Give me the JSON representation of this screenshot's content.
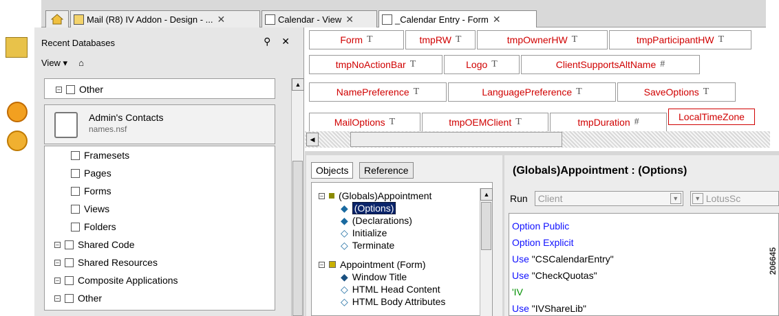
{
  "tabs": [
    {
      "label": "Mail (R8) IV Addon - Design - ...",
      "close": "✕"
    },
    {
      "label": "Calendar - View",
      "close": "✕"
    },
    {
      "label": "_Calendar Entry - Form",
      "close": "✕"
    }
  ],
  "panel": {
    "title": "Recent Databases",
    "actions": "⚲ ✕",
    "view_label": "View ▾",
    "items_top": [
      "Other"
    ],
    "db": {
      "name": "Admin's Contacts",
      "file": "names.nsf"
    },
    "items": [
      "Framesets",
      "Pages",
      "Forms",
      "Views",
      "Folders",
      "Shared Code",
      "Shared Resources",
      "Composite Applications",
      "Other"
    ]
  },
  "form_fields": [
    [
      "Form",
      "T"
    ],
    [
      "tmpRW",
      "T"
    ],
    [
      "tmpOwnerHW",
      "T"
    ],
    [
      "tmpParticipantHW",
      "T"
    ],
    [
      "tmpNoActionBar",
      "T"
    ],
    [
      "Logo",
      "T"
    ],
    [
      "ClientSupportsAltName",
      "#"
    ],
    [
      "NamePreference",
      "T"
    ],
    [
      "LanguagePreference",
      "T"
    ],
    [
      "SaveOptions",
      "T"
    ],
    [
      "MailOptions",
      "T"
    ],
    [
      "tmpOEMClient",
      "T"
    ],
    [
      "tmpDuration",
      "#"
    ],
    [
      "LocalTimeZone",
      ""
    ]
  ],
  "objects": {
    "tab_objects": "Objects",
    "tab_reference": "Reference",
    "tree": [
      {
        "label": "(Globals)Appointment",
        "level": 0
      },
      {
        "label": "(Options)",
        "level": 1,
        "selected": true
      },
      {
        "label": "(Declarations)",
        "level": 1
      },
      {
        "label": "Initialize",
        "level": 1
      },
      {
        "label": "Terminate",
        "level": 1
      },
      {
        "label": "Appointment (Form)",
        "level": 0
      },
      {
        "label": "Window Title",
        "level": 1
      },
      {
        "label": "HTML Head Content",
        "level": 1
      },
      {
        "label": "HTML Body Attributes",
        "level": 1
      }
    ]
  },
  "code": {
    "title": "(Globals)Appointment : (Options)",
    "run_label": "Run",
    "run_value": "Client",
    "lang_value": "LotusSc",
    "lines": [
      [
        "Option Public",
        ""
      ],
      [
        "Option Explicit",
        ""
      ],
      [
        "Use ",
        "\"CSCalendarEntry\""
      ],
      [
        "Use ",
        "\"CheckQuotas\""
      ],
      [
        "'IV",
        ""
      ],
      [
        "Use ",
        "\"IVShareLib\""
      ]
    ]
  },
  "watermark": "206645",
  "colors": {
    "field_text": "#d00000",
    "keyword": "#1010ff",
    "comment": "#009000"
  }
}
